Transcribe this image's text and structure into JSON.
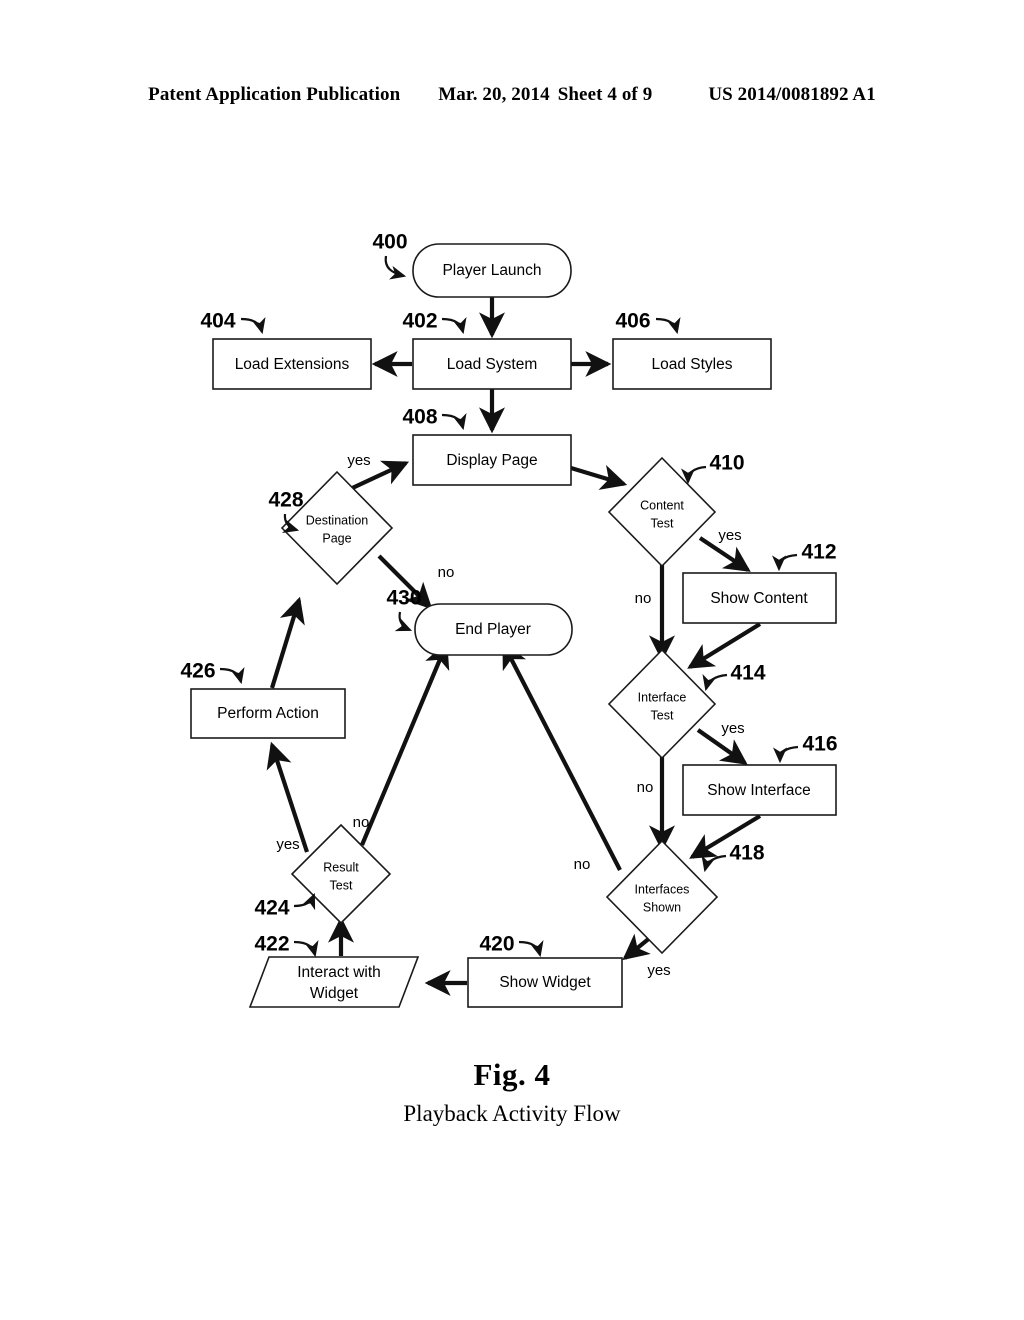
{
  "header": {
    "publication": "Patent Application Publication",
    "date": "Mar. 20, 2014",
    "sheet": "Sheet 4 of 9",
    "number": "US 2014/0081892 A1"
  },
  "caption": {
    "title": "Fig. 4",
    "subtitle": "Playback Activity Flow"
  },
  "diagram": {
    "nodes": {
      "player_launch": {
        "label": "Player Launch",
        "ref": "400",
        "shape": "terminator"
      },
      "load_system": {
        "label": "Load System",
        "ref": "402",
        "shape": "process"
      },
      "load_extensions": {
        "label": "Load Extensions",
        "ref": "404",
        "shape": "process"
      },
      "load_styles": {
        "label": "Load Styles",
        "ref": "406",
        "shape": "process"
      },
      "display_page": {
        "label": "Display Page",
        "ref": "408",
        "shape": "process"
      },
      "content_test": {
        "label_line1": "Content",
        "label_line2": "Test",
        "ref": "410",
        "shape": "decision"
      },
      "show_content": {
        "label": "Show Content",
        "ref": "412",
        "shape": "process"
      },
      "interface_test": {
        "label_line1": "Interface",
        "label_line2": "Test",
        "ref": "414",
        "shape": "decision"
      },
      "show_interface": {
        "label": "Show Interface",
        "ref": "416",
        "shape": "process"
      },
      "interfaces_shown": {
        "label_line1": "Interfaces",
        "label_line2": "Shown",
        "ref": "418",
        "shape": "decision"
      },
      "show_widget": {
        "label": "Show Widget",
        "ref": "420",
        "shape": "process"
      },
      "interact_with_widget": {
        "label_line1": "Interact with",
        "label_line2": "Widget",
        "ref": "422",
        "shape": "io-parallelogram"
      },
      "result_test": {
        "label_line1": "Result",
        "label_line2": "Test",
        "ref": "424",
        "shape": "decision"
      },
      "perform_action": {
        "label": "Perform Action",
        "ref": "426",
        "shape": "process"
      },
      "destination_page": {
        "label_line1": "Destination",
        "label_line2": "Page",
        "ref": "428",
        "shape": "decision"
      },
      "end_player": {
        "label": "End Player",
        "ref": "430",
        "shape": "terminator"
      }
    },
    "edge_labels": {
      "content_test_yes": "yes",
      "content_test_no": "no",
      "interface_test_yes": "yes",
      "interface_test_no": "no",
      "interfaces_shown_yes": "yes",
      "interfaces_shown_no": "no",
      "result_test_yes": "yes",
      "result_test_no": "no",
      "destination_page_yes": "yes",
      "destination_page_no": "no"
    }
  },
  "colors": {
    "ink": "#111111",
    "paper": "#ffffff"
  }
}
